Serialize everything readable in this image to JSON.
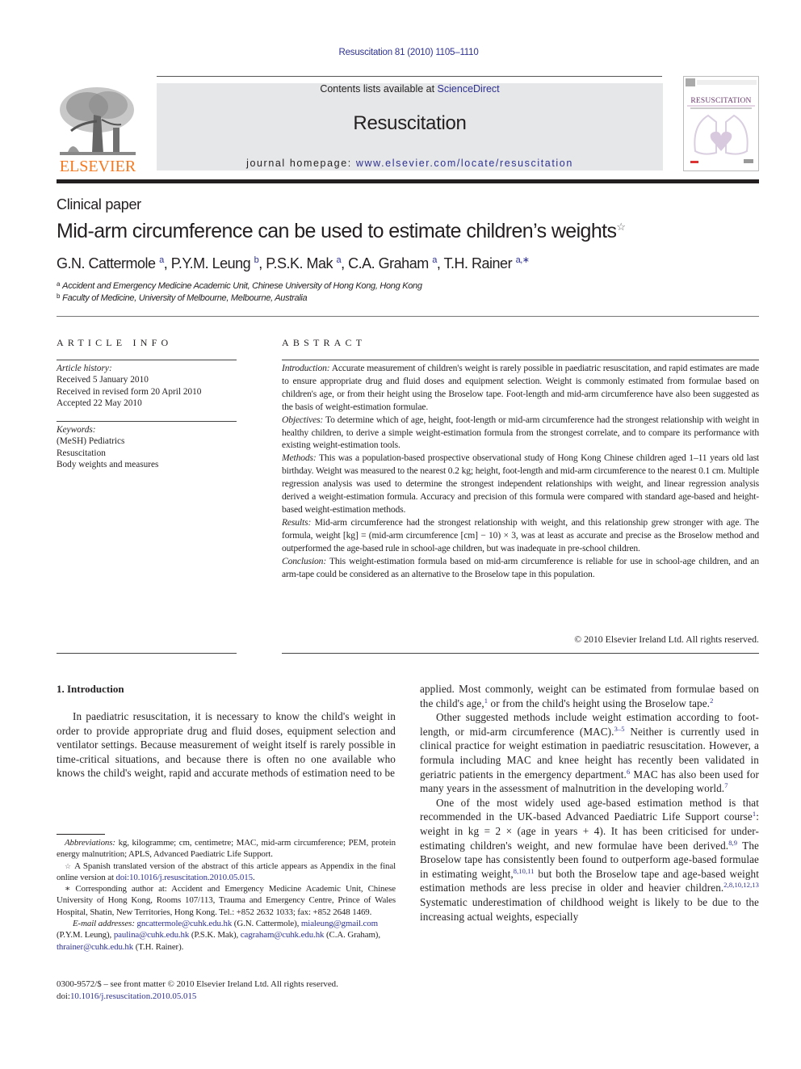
{
  "header": {
    "journal_ref": "Resuscitation 81 (2010) 1105–1110",
    "contents_prefix": "Contents lists available at ",
    "contents_link": "ScienceDirect",
    "journal_name": "Resuscitation",
    "homepage_prefix": "journal homepage: ",
    "homepage_link": "www.elsevier.com/locate/resuscitation",
    "publisher_logo_text": "ELSEVIER",
    "cover_title": "RESUSCITATION",
    "colors": {
      "link": "#2e3192",
      "publisher": "#f47920",
      "banner": "#e6e7e8"
    }
  },
  "article": {
    "section_type": "Clinical paper",
    "title": "Mid-arm circumference can be used to estimate children’s weights",
    "title_mark": "☆",
    "authors": [
      {
        "name": "G.N. Cattermole",
        "sup": "a"
      },
      {
        "name": "P.Y.M. Leung",
        "sup": "b"
      },
      {
        "name": "P.S.K. Mak",
        "sup": "a"
      },
      {
        "name": "C.A. Graham",
        "sup": "a"
      },
      {
        "name": "T.H. Rainer",
        "sup": "a,∗"
      }
    ],
    "affiliations": [
      {
        "sup": "a",
        "text": "Accident and Emergency Medicine Academic Unit, Chinese University of Hong Kong, Hong Kong"
      },
      {
        "sup": "b",
        "text": "Faculty of Medicine, University of Melbourne, Melbourne, Australia"
      }
    ]
  },
  "article_info": {
    "heading": "ARTICLE INFO",
    "history_label": "Article history:",
    "history": [
      "Received 5 January 2010",
      "Received in revised form 20 April 2010",
      "Accepted 22 May 2010"
    ],
    "keywords_label": "Keywords:",
    "keywords": [
      "(MeSH) Pediatrics",
      "Resuscitation",
      "Body weights and measures"
    ]
  },
  "abstract": {
    "heading": "ABSTRACT",
    "sections": [
      {
        "label": "Introduction:",
        "text": " Accurate measurement of children's weight is rarely possible in paediatric resuscitation, and rapid estimates are made to ensure appropriate drug and fluid doses and equipment selection. Weight is commonly estimated from formulae based on children's age, or from their height using the Broselow tape. Foot-length and mid-arm circumference have also been suggested as the basis of weight-estimation formulae."
      },
      {
        "label": "Objectives:",
        "text": " To determine which of age, height, foot-length or mid-arm circumference had the strongest relationship with weight in healthy children, to derive a simple weight-estimation formula from the strongest correlate, and to compare its performance with existing weight-estimation tools."
      },
      {
        "label": "Methods:",
        "text": " This was a population-based prospective observational study of Hong Kong Chinese children aged 1–11 years old last birthday. Weight was measured to the nearest 0.2 kg; height, foot-length and mid-arm circumference to the nearest 0.1 cm. Multiple regression analysis was used to determine the strongest independent relationships with weight, and linear regression analysis derived a weight-estimation formula. Accuracy and precision of this formula were compared with standard age-based and height-based weight-estimation methods."
      },
      {
        "label": "Results:",
        "text": " Mid-arm circumference had the strongest relationship with weight, and this relationship grew stronger with age. The formula, weight [kg] = (mid-arm circumference [cm] − 10) × 3, was at least as accurate and precise as the Broselow method and outperformed the age-based rule in school-age children, but was inadequate in pre-school children."
      },
      {
        "label": "Conclusion:",
        "text": " This weight-estimation formula based on mid-arm circumference is reliable for use in school-age children, and an arm-tape could be considered as an alternative to the Broselow tape in this population."
      }
    ],
    "copyright": "© 2010 Elsevier Ireland Ltd. All rights reserved."
  },
  "introduction": {
    "heading": "1.  Introduction",
    "left_para": "In paediatric resuscitation, it is necessary to know the child's weight in order to provide appropriate drug and fluid doses, equipment selection and ventilator settings. Because measurement of weight itself is rarely possible in time-critical situations, and because there is often no one available who knows the child's weight, rapid and accurate methods of estimation need to be",
    "right": {
      "p1": {
        "a": "applied. Most commonly, weight can be estimated from formulae based on the child's age,",
        "r1": "1",
        "b": " or from the child's height using the Broselow tape.",
        "r2": "2"
      },
      "p2": {
        "a": "Other suggested methods include weight estimation according to foot-length, or mid-arm circumference (MAC).",
        "r1": "3–5",
        "b": " Neither is currently used in clinical practice for weight estimation in paediatric resuscitation. However, a formula including MAC and knee height has recently been validated in geriatric patients in the emergency department.",
        "r2": "6",
        "c": " MAC has also been used for many years in the assessment of malnutrition in the developing world.",
        "r3": "7"
      },
      "p3": {
        "a": "One of the most widely used age-based estimation method is that recommended in the UK-based Advanced Paediatric Life Support course",
        "r1": "1",
        "b": ": weight in kg = 2 × (age in years + 4). It has been criticised for under-estimating children's weight, and new formulae have been derived.",
        "r2": "8,9",
        "c": " The Broselow tape has consistently been found to outperform age-based formulae in estimating weight,",
        "r3": "8,10,11",
        "d": " but both the Broselow tape and age-based weight estimation methods are less precise in older and heavier children.",
        "r4": "2,8,10,12,13",
        "e": " Systematic underestimation of childhood weight is likely to be due to the increasing actual weights, especially"
      }
    }
  },
  "footnotes": {
    "abbrev_label": "Abbreviations:",
    "abbrev_text": "  kg, kilogramme; cm, centimetre; MAC, mid-arm circumference; PEM, protein energy malnutrition; APLS, Advanced Paediatric Life Support.",
    "star_mark": "☆",
    "star_text": "  A Spanish translated version of the abstract of this article appears as Appendix in the final online version at ",
    "star_link": "doi:10.1016/j.resuscitation.2010.05.015",
    "star_end": ".",
    "corr_mark": "∗",
    "corr_text": "  Corresponding author at: Accident and Emergency Medicine Academic Unit, Chinese University of Hong Kong, Rooms 107/113, Trauma and Emergency Centre, Prince of Wales Hospital, Shatin, New Territories, Hong Kong. Tel.: +852 2632 1033; fax: +852 2648 1469.",
    "email_label": "E-mail addresses:",
    "emails": [
      {
        "address": "gncattermole@cuhk.edu.hk",
        "name": " (G.N. Cattermole),",
        "sep": " "
      },
      {
        "address": "mialeung@gmail.com",
        "name": " (P.Y.M. Leung),",
        "sep": " "
      },
      {
        "address": "paulina@cuhk.edu.hk",
        "name": " (P.S.K. Mak),",
        "sep": " "
      },
      {
        "address": "cagraham@cuhk.edu.hk",
        "name": " (C.A. Graham),",
        "sep": " "
      },
      {
        "address": "thrainer@cuhk.edu.hk",
        "name": " (T.H. Rainer).",
        "sep": ""
      }
    ]
  },
  "front_matter": {
    "issn_line": "0300-9572/$ – see front matter © 2010 Elsevier Ireland Ltd. All rights reserved.",
    "doi_prefix": "doi:",
    "doi_link": "10.1016/j.resuscitation.2010.05.015"
  }
}
